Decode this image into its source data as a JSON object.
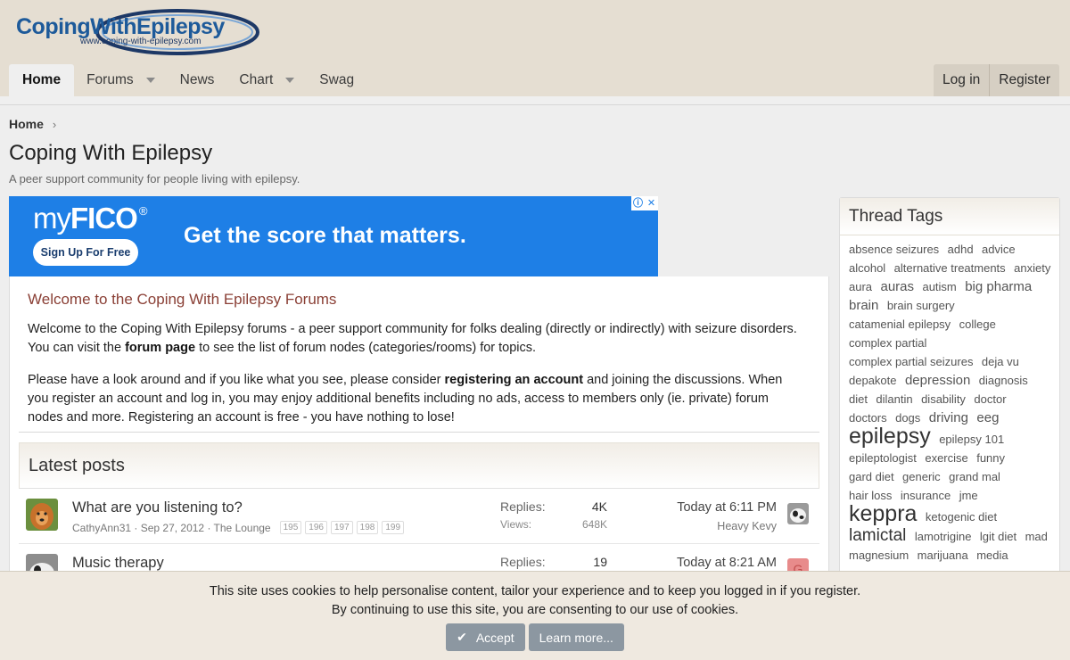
{
  "header": {
    "logo_title": "CopingWithEpilepsy",
    "logo_url": "www.coping-with-epilepsy.com",
    "nav": [
      {
        "label": "Home",
        "active": true
      },
      {
        "label": "Forums",
        "dropdown": true
      },
      {
        "label": "News"
      },
      {
        "label": "Chart",
        "dropdown": true
      },
      {
        "label": "Swag"
      }
    ],
    "login_label": "Log in",
    "register_label": "Register"
  },
  "breadcrumb": {
    "home": "Home"
  },
  "page": {
    "title": "Coping With Epilepsy",
    "description": "A peer support community for people living with epilepsy."
  },
  "ad": {
    "brand_pre": "my",
    "brand_bold": "FICO",
    "brand_reg": "®",
    "cta": "Sign Up For Free",
    "headline": "Get the score that matters."
  },
  "welcome": {
    "title": "Welcome to the Coping With Epilepsy Forums",
    "p1_a": "Welcome to the Coping With Epilepsy forums - a peer support community for folks dealing (directly or indirectly) with seizure disorders. You can visit the ",
    "p1_link": "forum page",
    "p1_b": " to see the list of forum nodes (categories/rooms) for topics.",
    "p2_a": "Please have a look around and if you like what you see, please consider ",
    "p2_link": "registering an account",
    "p2_b": " and joining the discussions. When you register an account and log in, you may enjoy additional benefits including no ads, access to members only (ie. private) forum nodes and more. Registering an account is free - you have nothing to lose!"
  },
  "latest": {
    "title": "Latest posts",
    "replies_label": "Replies:",
    "views_label": "Views:",
    "threads": [
      {
        "title": "What are you listening to?",
        "meta": "CathyAnn31 · Sep 27, 2012 · The Lounge",
        "pages": [
          "195",
          "196",
          "197",
          "198",
          "199"
        ],
        "replies": "4K",
        "views": "648K",
        "last_time": "Today at 6:11 PM",
        "last_user": "Heavy Kevy"
      },
      {
        "title": "Music therapy",
        "meta": "",
        "pages": [],
        "replies": "19",
        "views": "",
        "last_time": "Today at 8:21 AM",
        "last_user": "",
        "last_avatar_letter": "G"
      }
    ]
  },
  "sidebar": {
    "title": "Thread Tags",
    "tags": [
      {
        "t": "absence seizures",
        "s": 1
      },
      {
        "t": "adhd",
        "s": 1
      },
      {
        "t": "advice",
        "s": 1
      },
      {
        "t": "alcohol",
        "s": 1
      },
      {
        "t": "alternative treatments",
        "s": 1
      },
      {
        "t": "anxiety",
        "s": 1
      },
      {
        "t": "aura",
        "s": 1
      },
      {
        "t": "auras",
        "s": 2
      },
      {
        "t": "autism",
        "s": 1
      },
      {
        "t": "big pharma",
        "s": 2
      },
      {
        "t": "brain",
        "s": 2
      },
      {
        "t": "brain surgery",
        "s": 1
      },
      {
        "t": "catamenial epilepsy",
        "s": 1
      },
      {
        "t": "college",
        "s": 1
      },
      {
        "t": "complex partial",
        "s": 1
      },
      {
        "t": "complex partial seizures",
        "s": 1
      },
      {
        "t": "deja vu",
        "s": 1
      },
      {
        "t": "depakote",
        "s": 1
      },
      {
        "t": "depression",
        "s": 2
      },
      {
        "t": "diagnosis",
        "s": 1
      },
      {
        "t": "diet",
        "s": 1
      },
      {
        "t": "dilantin",
        "s": 1
      },
      {
        "t": "disability",
        "s": 1
      },
      {
        "t": "doctor",
        "s": 1
      },
      {
        "t": "doctors",
        "s": 1
      },
      {
        "t": "dogs",
        "s": 1
      },
      {
        "t": "driving",
        "s": 2
      },
      {
        "t": "eeg",
        "s": 2
      },
      {
        "t": "epilepsy",
        "s": 4
      },
      {
        "t": "epilepsy 101",
        "s": 1
      },
      {
        "t": "epileptologist",
        "s": 1
      },
      {
        "t": "exercise",
        "s": 1
      },
      {
        "t": "funny",
        "s": 1
      },
      {
        "t": "gard diet",
        "s": 1
      },
      {
        "t": "generic",
        "s": 1
      },
      {
        "t": "grand mal",
        "s": 1
      },
      {
        "t": "hair loss",
        "s": 1
      },
      {
        "t": "insurance",
        "s": 1
      },
      {
        "t": "jme",
        "s": 1
      },
      {
        "t": "keppra",
        "s": 4
      },
      {
        "t": "ketogenic diet",
        "s": 1
      },
      {
        "t": "lamictal",
        "s": 3
      },
      {
        "t": "lamotrigine",
        "s": 1
      },
      {
        "t": "lgit diet",
        "s": 1
      },
      {
        "t": "mad",
        "s": 1
      },
      {
        "t": "magnesium",
        "s": 1
      },
      {
        "t": "marijuana",
        "s": 1
      },
      {
        "t": "media",
        "s": 1
      }
    ]
  },
  "cookie": {
    "line1": "This site uses cookies to help personalise content, tailor your experience and to keep you logged in if you register.",
    "line2": "By continuing to use this site, you are consenting to our use of cookies.",
    "accept_label": "Accept",
    "learn_label": "Learn more..."
  },
  "colors": {
    "header_bg": "#e5ded2",
    "ad_bg": "#1e7fe6",
    "welcome_title": "#8a3f35",
    "cookie_btn": "#8c97a1"
  }
}
